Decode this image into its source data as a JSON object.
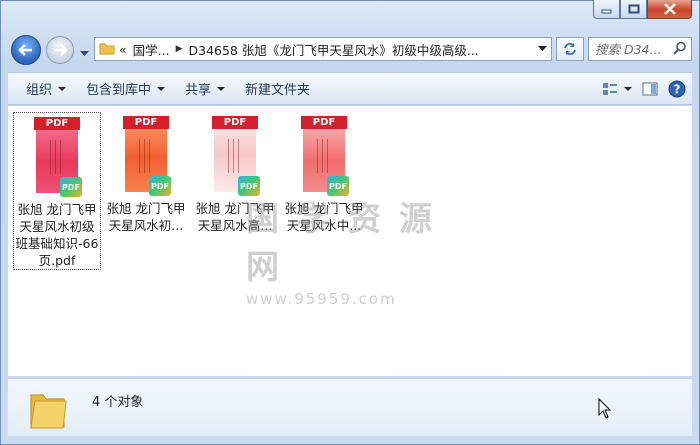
{
  "window": {
    "caption_buttons": [
      "minimize",
      "maximize",
      "close"
    ]
  },
  "nav": {
    "breadcrumb": [
      "«",
      "国学...",
      "D34658 张旭《龙门飞甲天星风水》初级中级高级..."
    ],
    "search_placeholder": "搜索 D34..."
  },
  "toolbar": {
    "items": [
      {
        "label": "组织",
        "has_dropdown": true
      },
      {
        "label": "包含到库中",
        "has_dropdown": true
      },
      {
        "label": "共享",
        "has_dropdown": true
      },
      {
        "label": "新建文件夹",
        "has_dropdown": false
      }
    ]
  },
  "files": [
    {
      "name": "张旭 龙门飞甲天星风水初级班基础知识-66页.pdf",
      "badge": "PDF",
      "tag": "PDF",
      "selected": true,
      "cover": "c1"
    },
    {
      "name": "张旭 龙门飞甲天星风水初...",
      "badge": "PDF",
      "tag": "PDF",
      "selected": false,
      "cover": "c2"
    },
    {
      "name": "张旭 龙门飞甲天星风水高...",
      "badge": "PDF",
      "tag": "PDF",
      "selected": false,
      "cover": "c3"
    },
    {
      "name": "张旭 龙门飞甲天星风水中...",
      "badge": "PDF",
      "tag": "PDF",
      "selected": false,
      "cover": "c4"
    }
  ],
  "watermark": {
    "text": "国学资源网",
    "url": "www.95959.com"
  },
  "status": {
    "count": "4 个对象"
  },
  "colors": {
    "pdf_red": "#d4202a",
    "back_button": "#2a63b8"
  }
}
